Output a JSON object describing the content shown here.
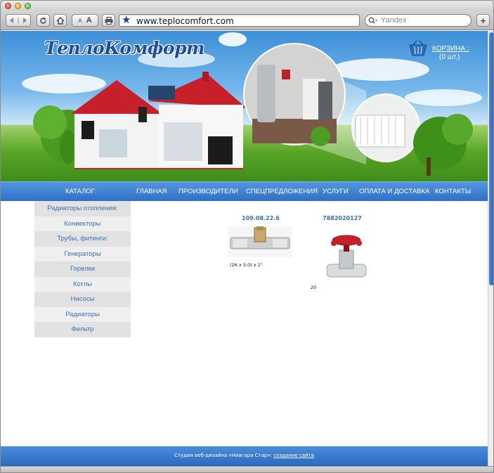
{
  "browser": {
    "url": "www.teplocomfort.com",
    "search_placeholder": "Yandex",
    "font_smaller": "A",
    "font_larger": "A",
    "new_tab": "+"
  },
  "site": {
    "logo": "ТеплоКомфорт",
    "cart": {
      "label": "КОРЗИНА :",
      "count": "(0 шт.)"
    }
  },
  "nav": {
    "catalog": "КАТАЛОГ:",
    "items": [
      "ГЛАВНАЯ",
      "ПРОИЗВОДИТЕЛИ",
      "СПЕЦПРЕДЛОЖЕНИЯ",
      "УСЛУГИ",
      "ОПЛАТА И ДОСТАВКА",
      "КОНТАКТЫ"
    ]
  },
  "sidebar": {
    "items": [
      "Радиаторы отопления:",
      "Конвекторы",
      "Трубы, фитинги:",
      "Генераторы",
      "Горелки",
      "Котлы",
      "Насосы",
      "Радиаторы",
      "Фильтр"
    ]
  },
  "products": [
    {
      "code": "109.08.22.6",
      "desc": "(26 x 3,0) x 1\""
    },
    {
      "code": "7882020127",
      "desc": "20"
    }
  ],
  "footer": {
    "text": "Студия веб-дизайна «Ниагара Стар»:",
    "link": "создание сайта"
  },
  "colors": {
    "nav_blue": "#2f6fc6",
    "sidebar_link": "#3a6fb5",
    "logo_blue": "#1f4d9b"
  }
}
